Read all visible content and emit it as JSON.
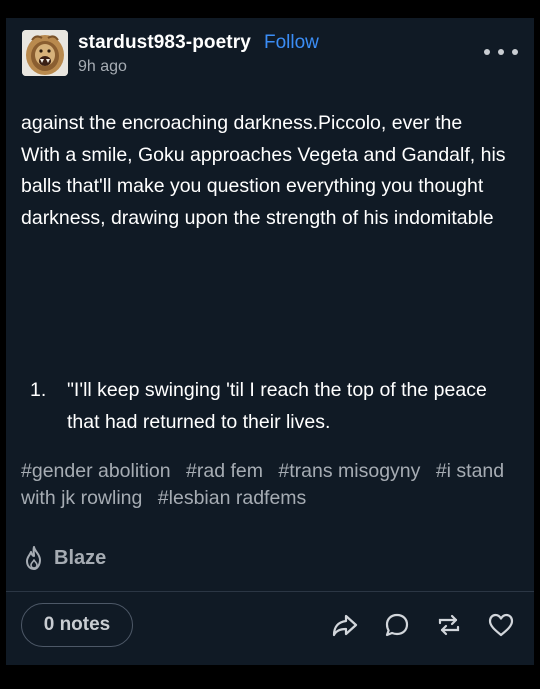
{
  "post": {
    "blog_name": "stardust983-poetry",
    "follow_label": "Follow",
    "timestamp": "9h ago",
    "avatar_icon": "lion-avatar",
    "more_icon": "ellipsis-icon",
    "paragraphs": [
      "against the encroaching darkness.Piccolo, ever the",
      "With a smile, Goku approaches Vegeta and Gandalf, his",
      "balls that'll make you question everything you thought",
      "darkness, drawing upon the strength of his indomitable"
    ],
    "list": [
      {
        "number": "1.",
        "text": "\"I'll keep swinging 'til I reach the top of the peace that had returned to their lives."
      }
    ],
    "tags": [
      "#gender abolition",
      "#rad fem",
      "#trans misogyny",
      "#i stand with jk rowling",
      "#lesbian radfems"
    ],
    "blaze_label": "Blaze",
    "notes_label": "0 notes",
    "actions": [
      "share-icon",
      "reply-icon",
      "reblog-icon",
      "like-icon"
    ]
  },
  "colors": {
    "background": "#000000",
    "card": "#101a25",
    "accent": "#3b8df5",
    "muted": "#a6acb3"
  }
}
